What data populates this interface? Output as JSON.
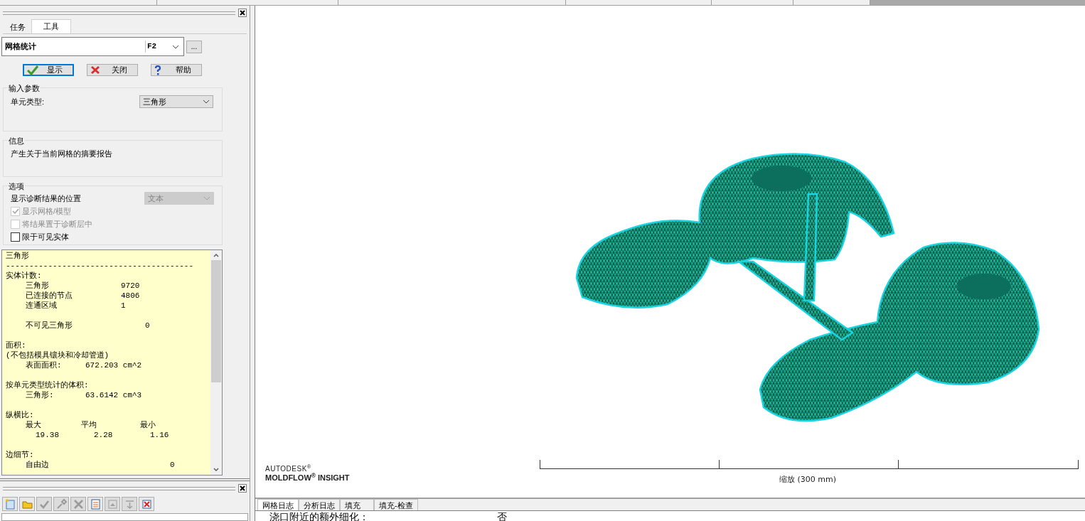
{
  "panel": {
    "tabs": [
      {
        "label": "任务",
        "selected": false
      },
      {
        "label": "工具",
        "selected": true
      }
    ],
    "tool": {
      "name": "网格统计",
      "shortcut": "F2",
      "more": "..."
    },
    "buttons": [
      {
        "kind": "ok",
        "label": "显示",
        "focused": true
      },
      {
        "kind": "cancel",
        "label": "关闭",
        "focused": false
      },
      {
        "kind": "help",
        "label": "帮助",
        "focused": false
      }
    ],
    "input_group": {
      "title": "输入参数",
      "label": "单元类型:",
      "value": "三角形"
    },
    "info_group": {
      "title": "信息",
      "text": "产生关于当前网格的摘要报告"
    },
    "options_group": {
      "title": "选项",
      "location_label": "显示诊断结果的位置",
      "location_value": "文本",
      "location_disabled": true,
      "checkboxes": [
        {
          "label": "显示网格/模型",
          "checked": true,
          "disabled": true
        },
        {
          "label": "将结果置于诊断层中",
          "checked": false,
          "disabled": true
        },
        {
          "label": "限于可见实体",
          "checked": false,
          "disabled": false
        }
      ]
    },
    "report": [
      {
        "kind": "heading",
        "cells": [
          "三角形"
        ]
      },
      {
        "kind": "heading",
        "cells": [
          "----------------------------------------"
        ]
      },
      {
        "kind": "heading",
        "cells": [
          "实体计数:"
        ]
      },
      {
        "kind": "count",
        "cells": [
          "三角形",
          "9720"
        ]
      },
      {
        "kind": "count",
        "cells": [
          "已连接的节点",
          "4806"
        ]
      },
      {
        "kind": "count",
        "cells": [
          "连通区域",
          "1"
        ]
      },
      {
        "kind": "blank"
      },
      {
        "kind": "count_far",
        "cells": [
          "不可见三角形",
          "0"
        ]
      },
      {
        "kind": "blank"
      },
      {
        "kind": "heading",
        "cells": [
          "面积:"
        ]
      },
      {
        "kind": "heading",
        "cells": [
          "(不包括模具镶块和冷却管道)"
        ]
      },
      {
        "kind": "measure",
        "cells": [
          "表面面积:",
          "672.203 cm^2"
        ]
      },
      {
        "kind": "blank"
      },
      {
        "kind": "heading",
        "cells": [
          "按单元类型统计的体积:"
        ]
      },
      {
        "kind": "measure",
        "cells": [
          "三角形:",
          "63.6142 cm^3"
        ]
      },
      {
        "kind": "blank"
      },
      {
        "kind": "heading",
        "cells": [
          "纵横比:"
        ]
      },
      {
        "kind": "triple",
        "cells": [
          "最大",
          "平均",
          "最小"
        ]
      },
      {
        "kind": "triple_values",
        "cells": [
          "19.38",
          "2.28",
          "1.16"
        ]
      },
      {
        "kind": "blank"
      },
      {
        "kind": "heading",
        "cells": [
          "边细节:"
        ]
      },
      {
        "kind": "edge",
        "cells": [
          "自由边",
          "0"
        ]
      }
    ],
    "toolbar": [
      {
        "kind": "new",
        "disabled": false
      },
      {
        "kind": "folder",
        "disabled": false
      },
      {
        "kind": "check",
        "disabled": true
      },
      {
        "kind": "torch",
        "disabled": true
      },
      {
        "kind": "cross",
        "disabled": true
      },
      {
        "kind": "list",
        "disabled": false
      },
      {
        "kind": "up",
        "disabled": true
      },
      {
        "kind": "down",
        "disabled": true
      },
      {
        "kind": "delete",
        "disabled": false
      }
    ]
  },
  "viewport": {
    "logo_top": "AUTODESK$^{®}$",
    "logo_bottom": "MOLDFLOW$^{®}$ INSIGHT",
    "scale_label": "缩放 (300 mm)"
  },
  "log": {
    "tabs": [
      {
        "label": "网格日志",
        "selected": true
      },
      {
        "label": "分析日志",
        "selected": false
      },
      {
        "label": "填充",
        "selected": false
      },
      {
        "label": "填充-检查",
        "selected": false
      }
    ],
    "line": {
      "label": "浇口附近的额外细化：",
      "value": "否"
    }
  }
}
